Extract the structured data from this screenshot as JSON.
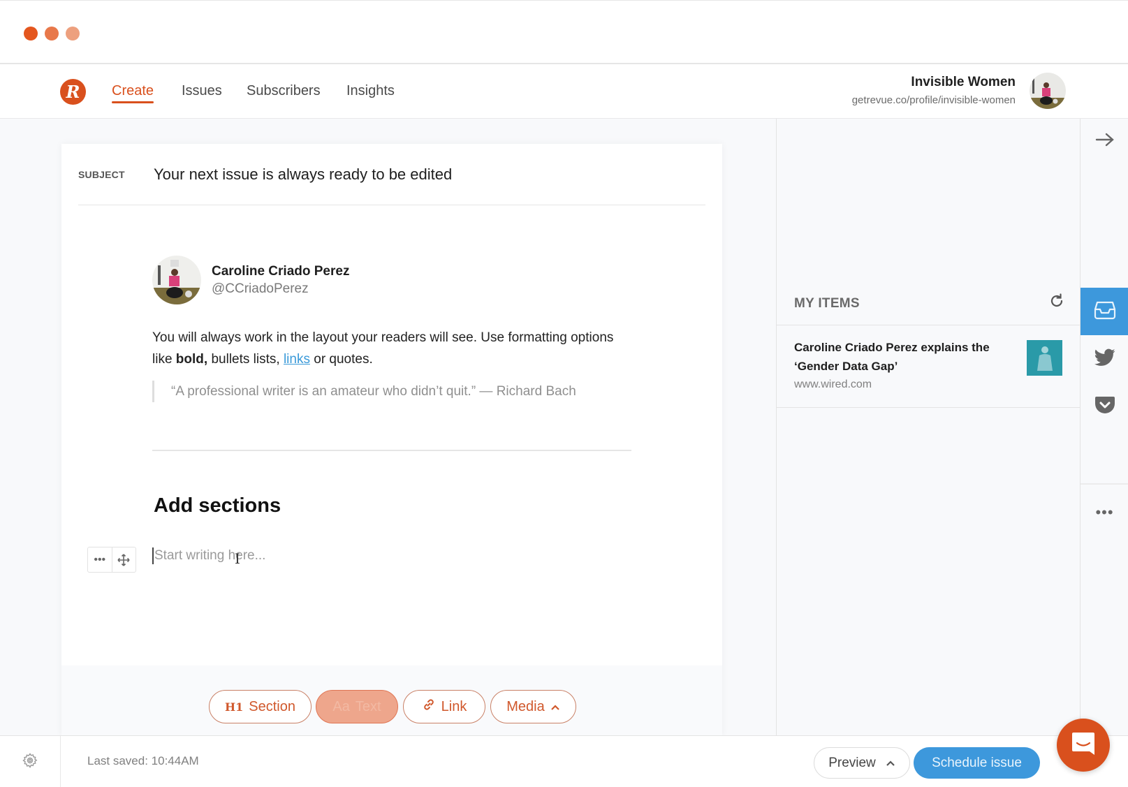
{
  "window": {
    "traffic_lights": [
      "close",
      "minimize",
      "zoom"
    ],
    "colors": {
      "close": "#e4561e",
      "minimize": "#e8784a",
      "zoom": "#eda07e"
    }
  },
  "header": {
    "logo_letter": "R",
    "nav": [
      {
        "label": "Create",
        "active": true
      },
      {
        "label": "Issues",
        "active": false
      },
      {
        "label": "Subscribers",
        "active": false
      },
      {
        "label": "Insights",
        "active": false
      }
    ],
    "profile": {
      "name": "Invisible Women",
      "url": "getrevue.co/profile/invisible-women"
    }
  },
  "editor": {
    "subject_label": "SUBJECT",
    "subject_value": "Your next issue is always ready to be edited",
    "tweet": {
      "author_name": "Caroline Criado Perez",
      "author_handle": "@CCriadoPerez",
      "body_before_bold": "You will always work in the layout your readers will see. Use formatting options like ",
      "body_bold": "bold,",
      "body_middle": " bullets lists, ",
      "body_link": "links",
      "body_after": " or quotes.",
      "quote": "“A professional writer is an amateur who didn’t quit.” — Richard Bach"
    },
    "section_heading": "Add sections",
    "block_tools": {
      "more_icon": "•••",
      "move_icon": "✛"
    },
    "placeholder": "Start writing here...",
    "toolbar": {
      "section_icon": "H1",
      "section_label": "Section",
      "text_icon": "Aa",
      "text_label": "Text",
      "link_label": "Link",
      "media_label": "Media"
    }
  },
  "side_panel": {
    "title": "MY ITEMS",
    "items": [
      {
        "title": "Caroline Criado Perez explains the ‘Gender Data Gap’",
        "domain": "www.wired.com"
      }
    ]
  },
  "rail": {
    "collapse_icon": "→",
    "buttons": [
      "inbox",
      "twitter",
      "pocket"
    ],
    "active": "inbox",
    "more_icon": "•••",
    "active_color": "#3d98dc"
  },
  "footer": {
    "last_saved": "Last saved: 10:44AM",
    "preview_label": "Preview",
    "schedule_label": "Schedule issue"
  },
  "theme": {
    "brand": "#d9501d",
    "accent_blue": "#3d98dc",
    "link": "#3a9ad9"
  }
}
